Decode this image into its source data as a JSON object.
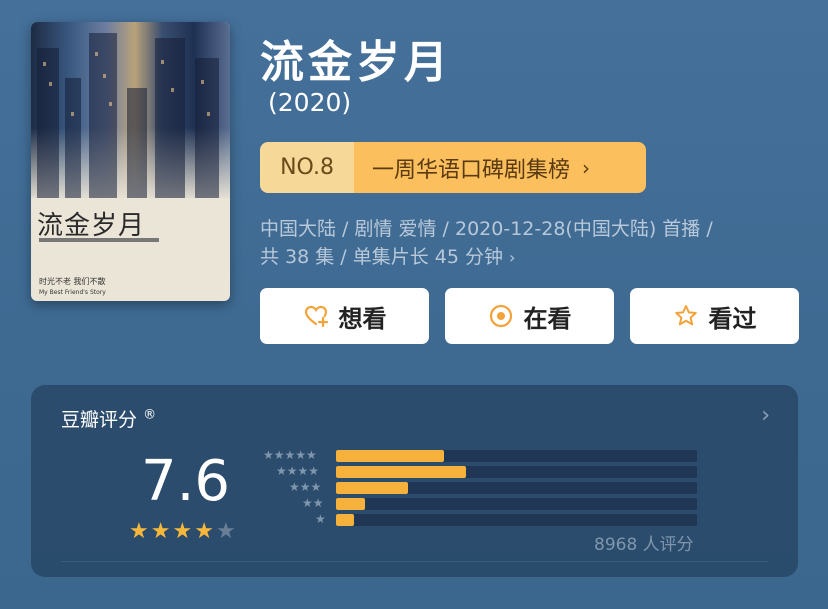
{
  "show": {
    "title": "流金岁月",
    "year": "(2020)",
    "rank": {
      "no": "NO.8",
      "list": "一周华语口碑剧集榜",
      "chevron": "›"
    },
    "meta_line1": "中国大陆 / 剧情 爱情 / 2020-12-28(中国大陆) 首播 /",
    "meta_line2": "共 38 集 / 单集片长 45 分钟",
    "meta_chevron": "›"
  },
  "poster": {
    "title": "流金岁月",
    "tagline1": "时光不老 我们不散",
    "tagline2": "My Best Friend's Story"
  },
  "actions": [
    {
      "label": "想看",
      "icon": "heart-plus-icon",
      "color": "#f2a33a"
    },
    {
      "label": "在看",
      "icon": "circle-dot-icon",
      "color": "#f2a33a"
    },
    {
      "label": "看过",
      "icon": "star-outline-icon",
      "color": "#f2a33a"
    }
  ],
  "rating": {
    "title": "豆瓣评分",
    "registered": "®",
    "chevron": "›",
    "score": "7.6",
    "stars_filled": 4,
    "stars_total": 5,
    "distribution": [
      {
        "stars": "★★★★★",
        "fraction": 0.3
      },
      {
        "stars": "★★★★",
        "fraction": 0.36
      },
      {
        "stars": "★★★",
        "fraction": 0.2
      },
      {
        "stars": "★★",
        "fraction": 0.08
      },
      {
        "stars": "★",
        "fraction": 0.05
      }
    ],
    "count_text": "8968 人评分",
    "accent": "#f4b23c"
  }
}
